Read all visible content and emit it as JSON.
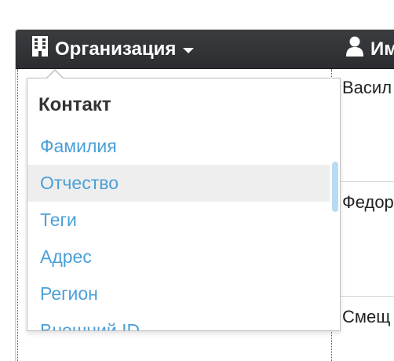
{
  "header": {
    "org_label": "Организация",
    "name_label": "Им",
    "org_icon": "building-icon",
    "name_icon": "user-icon"
  },
  "rows": [
    {
      "name": "Васил"
    },
    {
      "name": "Федор"
    },
    {
      "name": "Смещ"
    }
  ],
  "dropdown": {
    "heading": "Контакт",
    "items": [
      {
        "label": "Фамилия"
      },
      {
        "label": "Отчество"
      },
      {
        "label": "Теги"
      },
      {
        "label": "Адрес"
      },
      {
        "label": "Регион"
      },
      {
        "label": "Внешний ID"
      }
    ],
    "hovered_item": "Отчество"
  },
  "colors": {
    "header_bg": "#2b2d30",
    "link": "#4a9fd8",
    "hover_bg": "#eeeeee",
    "scrollbar": "#b9dbf1"
  }
}
